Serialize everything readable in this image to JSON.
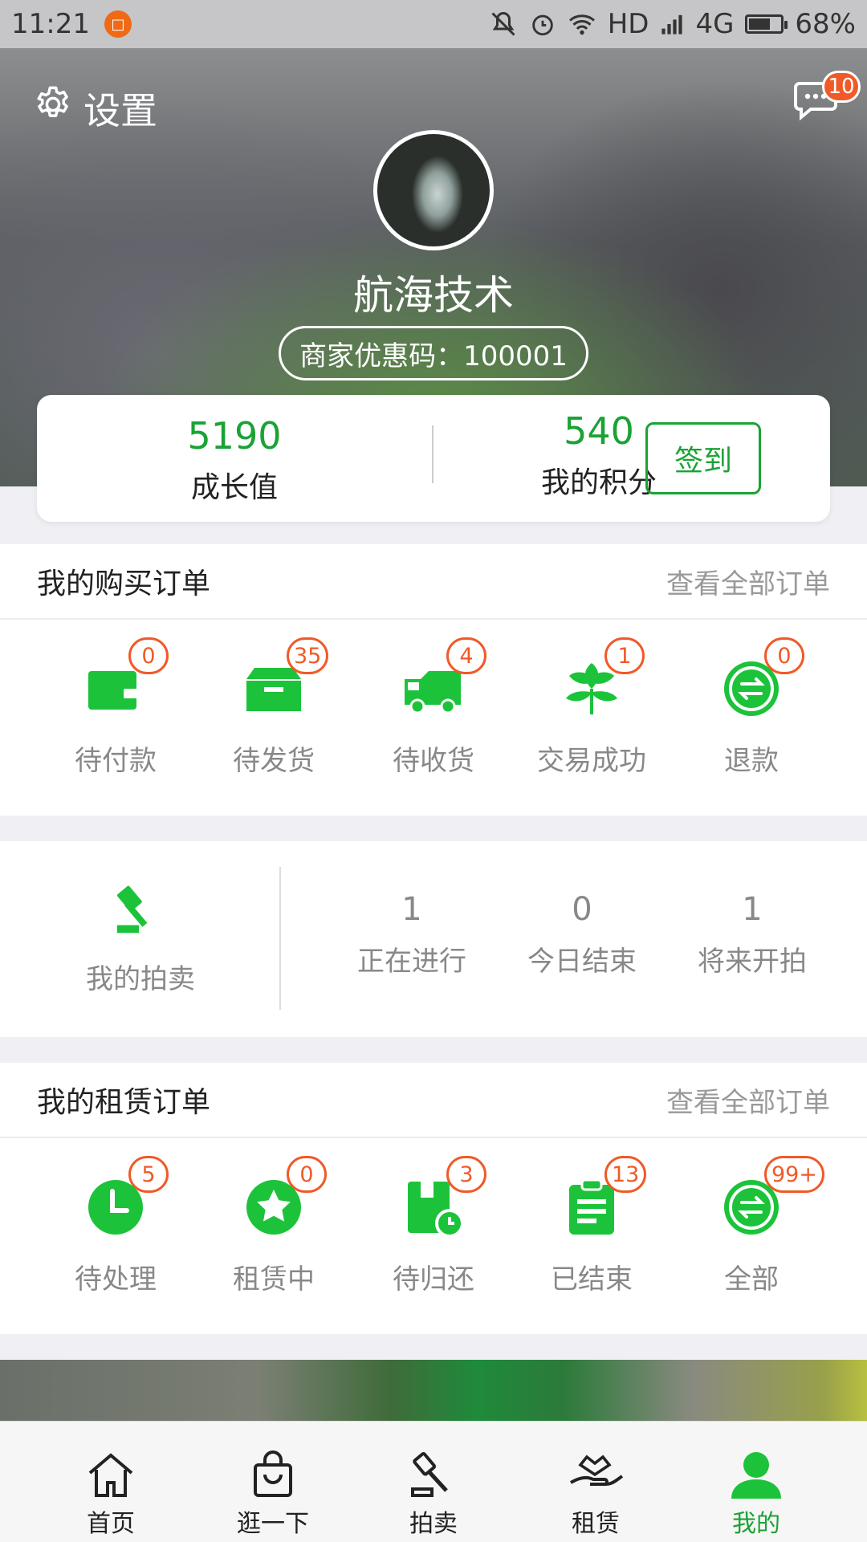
{
  "status_bar": {
    "time": "11:21",
    "network": "HD",
    "signal": "4G",
    "battery": "68%",
    "battery_level": 0.68
  },
  "header": {
    "settings_label": "设置",
    "message_count": "10",
    "username": "航海技术",
    "coupon": "商家优惠码：100001"
  },
  "stats": {
    "growth_value": "5190",
    "growth_label": "成长值",
    "points_value": "540",
    "points_label": "我的积分",
    "signin_label": "签到"
  },
  "purchase_orders": {
    "title": "我的购买订单",
    "view_all": "查看全部订单",
    "items": [
      {
        "label": "待付款",
        "count": "0",
        "icon": "wallet-icon"
      },
      {
        "label": "待发货",
        "count": "35",
        "icon": "box-icon"
      },
      {
        "label": "待收货",
        "count": "4",
        "icon": "truck-icon"
      },
      {
        "label": "交易成功",
        "count": "1",
        "icon": "plant-icon"
      },
      {
        "label": "退款",
        "count": "0",
        "icon": "exchange-icon"
      }
    ]
  },
  "auction": {
    "title": "我的拍卖",
    "stats": [
      {
        "label": "正在进行",
        "value": "1"
      },
      {
        "label": "今日结束",
        "value": "0"
      },
      {
        "label": "将来开拍",
        "value": "1"
      }
    ]
  },
  "rental_orders": {
    "title": "我的租赁订单",
    "view_all": "查看全部订单",
    "items": [
      {
        "label": "待处理",
        "count": "5",
        "icon": "clock-icon"
      },
      {
        "label": "租赁中",
        "count": "0",
        "icon": "star-icon"
      },
      {
        "label": "待归还",
        "count": "3",
        "icon": "return-box-icon"
      },
      {
        "label": "已结束",
        "count": "13",
        "icon": "clipboard-icon"
      },
      {
        "label": "全部",
        "count": "99+",
        "icon": "exchange-icon"
      }
    ]
  },
  "tabbar": {
    "items": [
      {
        "label": "首页",
        "icon": "home-icon"
      },
      {
        "label": "逛一下",
        "icon": "bag-icon"
      },
      {
        "label": "拍卖",
        "icon": "gavel-icon"
      },
      {
        "label": "租赁",
        "icon": "hand-icon"
      },
      {
        "label": "我的",
        "icon": "user-icon",
        "active": true
      }
    ]
  },
  "colors": {
    "accent": "#1aa334",
    "badge": "#f05a28"
  }
}
